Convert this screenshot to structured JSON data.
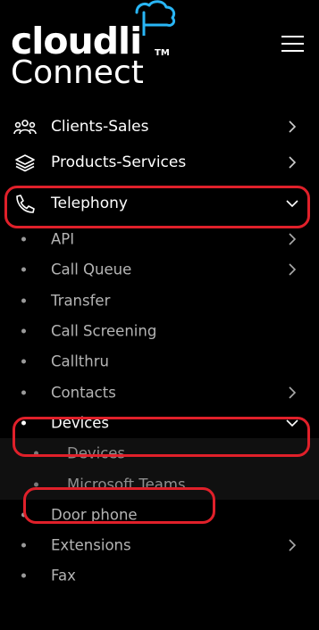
{
  "logo": {
    "brand": "cloudli",
    "trademark": "TM",
    "product": "Connect"
  },
  "nav": {
    "top_items": [
      {
        "label": "Clients-Sales",
        "icon": "users-group-icon",
        "chevron": "right"
      },
      {
        "label": "Products-Services",
        "icon": "layers-icon",
        "chevron": "right"
      },
      {
        "label": "Telephony",
        "icon": "phone-icon",
        "chevron": "down"
      }
    ],
    "telephony_items": [
      {
        "label": "API",
        "chevron": "right"
      },
      {
        "label": "Call Queue",
        "chevron": "right"
      },
      {
        "label": "Transfer"
      },
      {
        "label": "Call Screening"
      },
      {
        "label": "Callthru"
      },
      {
        "label": "Contacts",
        "chevron": "right"
      },
      {
        "label": "Devices",
        "chevron": "down"
      }
    ],
    "devices_items": [
      {
        "label": "Devices"
      },
      {
        "label": "Microsoft Teams"
      }
    ],
    "after_items": [
      {
        "label": "Door phone"
      },
      {
        "label": "Extensions",
        "chevron": "right"
      },
      {
        "label": "Fax"
      }
    ]
  },
  "colors": {
    "background": "#000000",
    "highlight_border": "#e0202a",
    "logo_cloud": "#29b6f6"
  }
}
